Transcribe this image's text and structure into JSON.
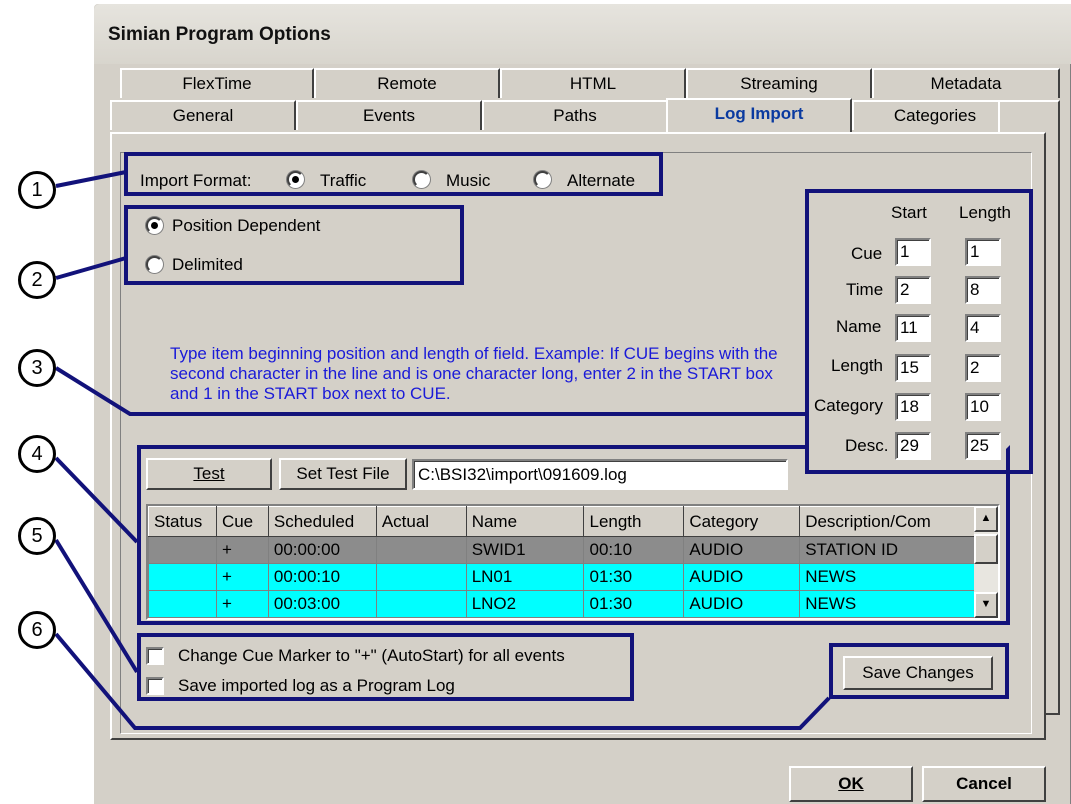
{
  "window": {
    "title": "Simian Program Options"
  },
  "tabs": {
    "row1": [
      "FlexTime",
      "Remote",
      "HTML",
      "Streaming",
      "Metadata"
    ],
    "row2": [
      "General",
      "Events",
      "Paths",
      "Log Import",
      "Categories"
    ]
  },
  "import": {
    "label": "Import Format:",
    "options": [
      "Traffic",
      "Music",
      "Alternate"
    ],
    "selected": "Traffic"
  },
  "mode": {
    "options": [
      "Position Dependent",
      "Delimited"
    ],
    "selected": "Position Dependent"
  },
  "fields": {
    "start_header": "Start",
    "length_header": "Length",
    "rows": [
      {
        "label": "Cue",
        "start": "1",
        "length": "1"
      },
      {
        "label": "Time",
        "start": "2",
        "length": "8"
      },
      {
        "label": "Name",
        "start": "11",
        "length": "4"
      },
      {
        "label": "Length",
        "start": "15",
        "length": "2"
      },
      {
        "label": "Category",
        "start": "18",
        "length": "10"
      },
      {
        "label": "Desc.",
        "start": "29",
        "length": "25"
      }
    ]
  },
  "info_text": "Type item beginning position and length of field. Example: If CUE begins with the second character in the line and is one character long, enter 2 in the START box and 1 in the START box next to CUE.",
  "test": {
    "button": "Test",
    "set_file_button": "Set Test File",
    "file_path": "C:\\BSI32\\import\\091609.log"
  },
  "grid": {
    "columns": [
      "Status",
      "Cue",
      "Scheduled",
      "Actual",
      "Name",
      "Length",
      "Category",
      "Description/Com"
    ],
    "rows": [
      [
        "",
        "+",
        "00:00:00",
        "",
        "SWID1",
        "00:10",
        "AUDIO",
        "STATION ID"
      ],
      [
        "",
        "+",
        "00:00:10",
        "",
        "LN01",
        "01:30",
        "AUDIO",
        "NEWS"
      ],
      [
        "",
        "+",
        "00:03:00",
        "",
        "LNO2",
        "01:30",
        "AUDIO",
        "NEWS"
      ]
    ]
  },
  "options": {
    "change_cue": "Change Cue Marker to \"+\" (AutoStart) for all events",
    "save_log": "Save imported log as a Program Log"
  },
  "buttons": {
    "save": "Save Changes",
    "ok": "OK",
    "cancel": "Cancel"
  },
  "callouts": [
    "1",
    "2",
    "3",
    "4",
    "5",
    "6"
  ],
  "colors": {
    "highlight": "#12127a",
    "info_text": "#1a1ad8",
    "row_cyan": "#00ffff",
    "active_tab": "#0a3aa0"
  }
}
